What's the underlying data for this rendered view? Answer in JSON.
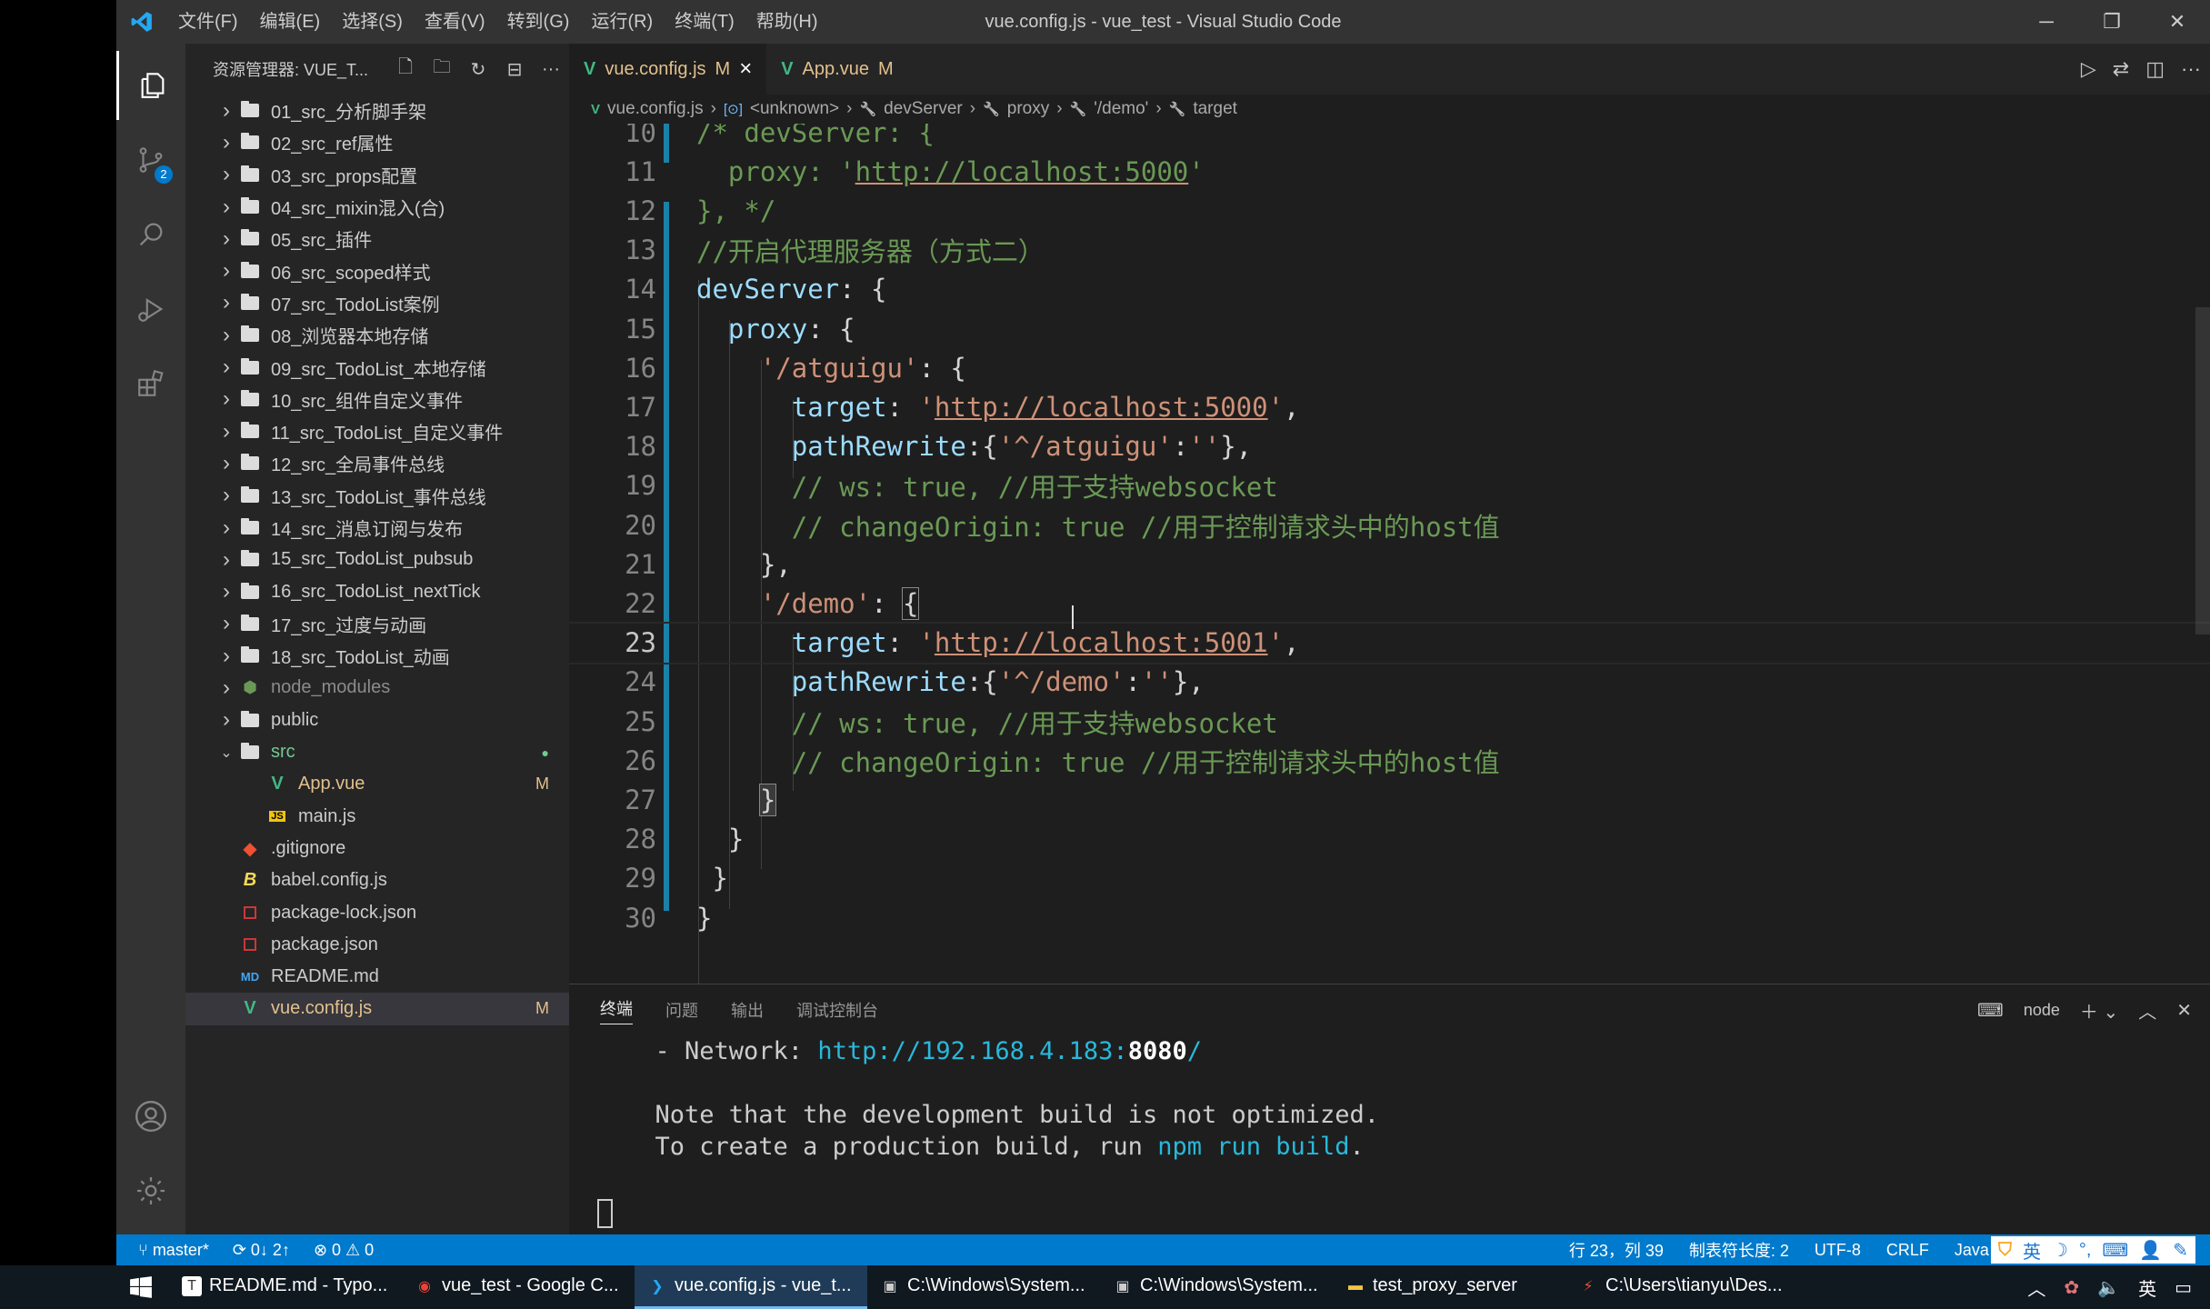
{
  "window": {
    "title": "vue.config.js - vue_test - Visual Studio Code",
    "menu": [
      "文件(F)",
      "编辑(E)",
      "选择(S)",
      "查看(V)",
      "转到(G)",
      "运行(R)",
      "终端(T)",
      "帮助(H)"
    ]
  },
  "activity": {
    "scm_badge": "2"
  },
  "sidebar": {
    "title": "资源管理器: VUE_T...",
    "tree": [
      {
        "label": "01_src_分析脚手架",
        "type": "folder"
      },
      {
        "label": "02_src_ref属性",
        "type": "folder"
      },
      {
        "label": "03_src_props配置",
        "type": "folder"
      },
      {
        "label": "04_src_mixin混入(合)",
        "type": "folder"
      },
      {
        "label": "05_src_插件",
        "type": "folder"
      },
      {
        "label": "06_src_scoped样式",
        "type": "folder"
      },
      {
        "label": "07_src_TodoList案例",
        "type": "folder"
      },
      {
        "label": "08_浏览器本地存储",
        "type": "folder"
      },
      {
        "label": "09_src_TodoList_本地存储",
        "type": "folder"
      },
      {
        "label": "10_src_组件自定义事件",
        "type": "folder"
      },
      {
        "label": "11_src_TodoList_自定义事件",
        "type": "folder"
      },
      {
        "label": "12_src_全局事件总线",
        "type": "folder"
      },
      {
        "label": "13_src_TodoList_事件总线",
        "type": "folder"
      },
      {
        "label": "14_src_消息订阅与发布",
        "type": "folder"
      },
      {
        "label": "15_src_TodoList_pubsub",
        "type": "folder"
      },
      {
        "label": "16_src_TodoList_nextTick",
        "type": "folder"
      },
      {
        "label": "17_src_过度与动画",
        "type": "folder"
      },
      {
        "label": "18_src_TodoList_动画",
        "type": "folder"
      },
      {
        "label": "node_modules",
        "type": "node"
      },
      {
        "label": "public",
        "type": "folder"
      },
      {
        "label": "src",
        "type": "open-folder",
        "status": "●"
      },
      {
        "label": "App.vue",
        "type": "vue",
        "status": "M",
        "indent": 1
      },
      {
        "label": "main.js",
        "type": "js",
        "indent": 1
      },
      {
        "label": ".gitignore",
        "type": "git"
      },
      {
        "label": "babel.config.js",
        "type": "babel"
      },
      {
        "label": "package-lock.json",
        "type": "npm"
      },
      {
        "label": "package.json",
        "type": "npm"
      },
      {
        "label": "README.md",
        "type": "md"
      },
      {
        "label": "vue.config.js",
        "type": "vue",
        "status": "M",
        "selected": true
      }
    ]
  },
  "tabs": [
    {
      "name": "vue.config.js",
      "status": "M",
      "close": "×",
      "active": true
    },
    {
      "name": "App.vue",
      "status": "M",
      "active": false
    }
  ],
  "breadcrumb": [
    "vue.config.js",
    "<unknown>",
    "devServer",
    "proxy",
    "'/demo'",
    "target"
  ],
  "code": {
    "current_line": 23,
    "lines": [
      {
        "n": "10",
        "html": "<span class='c-comment'>/* devServer: {</span>"
      },
      {
        "n": "11",
        "html": "<span class='c-comment'>  proxy: '<u>http://localhost:5000</u>'</span>"
      },
      {
        "n": "12",
        "html": "<span class='c-comment'>}, */</span>"
      },
      {
        "n": "13",
        "html": "<span class='c-comment'>//开启代理服务器（方式二）</span>"
      },
      {
        "n": "14",
        "html": "<span class='c-prop'>devServer</span><span class='c-punc'>: {</span>"
      },
      {
        "n": "15",
        "html": "  <span class='c-prop'>proxy</span><span class='c-punc'>: {</span>"
      },
      {
        "n": "16",
        "html": "    <span class='c-str'>'/atguigu'</span><span class='c-punc'>: {</span>"
      },
      {
        "n": "17",
        "html": "      <span class='c-prop'>target</span><span class='c-punc'>: </span><span class='c-str'>'<u>http://localhost:5000</u>'</span><span class='c-punc'>,</span>"
      },
      {
        "n": "18",
        "html": "      <span class='c-prop'>pathRewrite</span><span class='c-punc'>:{</span><span class='c-str'>'^/atguigu'</span><span class='c-punc'>:</span><span class='c-str'>''</span><span class='c-punc'>},</span>"
      },
      {
        "n": "19",
        "html": "      <span class='c-comment'>// ws: true, //用于支持websocket</span>"
      },
      {
        "n": "20",
        "html": "      <span class='c-comment'>// changeOrigin: true //用于控制请求头中的host值</span>"
      },
      {
        "n": "21",
        "html": "    <span class='c-punc'>},</span>"
      },
      {
        "n": "22",
        "html": "    <span class='c-str'>'/demo'</span><span class='c-punc'>: </span><span class='c-punc' style='outline:1px solid #888'>{</span>"
      },
      {
        "n": "23",
        "html": "      <span class='c-prop'>target</span><span class='c-punc'>: </span><span class='c-str'>'<u>http://localhost:5001</u>'</span><span class='c-punc'>,</span>"
      },
      {
        "n": "24",
        "html": "      <span class='c-prop'>pathRewrite</span><span class='c-punc'>:{</span><span class='c-str'>'^/demo'</span><span class='c-punc'>:</span><span class='c-str'>''</span><span class='c-punc'>},</span>"
      },
      {
        "n": "25",
        "html": "      <span class='c-comment'>// ws: true, //用于支持websocket</span>"
      },
      {
        "n": "26",
        "html": "      <span class='c-comment'>// changeOrigin: true //用于控制请求头中的host值</span>"
      },
      {
        "n": "27",
        "html": "    <span class='c-punc' style='outline:1px solid #888;background:#3a3a3a'>}</span>"
      },
      {
        "n": "28",
        "html": "  <span class='c-punc'>}</span>"
      },
      {
        "n": "29",
        "html": " <span class='c-punc'>}</span>"
      },
      {
        "n": "30",
        "html": "<span class='c-punc'>}</span>"
      }
    ]
  },
  "panel": {
    "tabs": [
      "终端",
      "问题",
      "输出",
      "调试控制台"
    ],
    "active_tab": "终端",
    "terminal_name": "node",
    "output": {
      "network_prefix": "  - Network: ",
      "network_url": "http://192.168.4.183:",
      "network_port": "8080",
      "network_slash": "/",
      "note_line": "  Note that the development build is not optimized.",
      "build_prefix": "  To create a production build, run ",
      "build_cmd": "npm run build",
      "build_suffix": "."
    }
  },
  "statusbar": {
    "branch": "master*",
    "sync": "0↓ 2↑",
    "problems": "⊗ 0 ⚠ 0",
    "position": "行 23，列 39",
    "tab_size": "制表符长度: 2",
    "encoding": "UTF-8",
    "eol": "CRLF",
    "language": "Java",
    "ime": "英"
  },
  "taskbar": {
    "items": [
      {
        "label": "README.md - Typo...",
        "icon": "typora-icon",
        "color": "#ffffff"
      },
      {
        "label": "vue_test - Google C...",
        "icon": "chrome-icon",
        "color": "#ea4335"
      },
      {
        "label": "vue.config.js - vue_t...",
        "icon": "vscode-icon",
        "color": "#23a9f2",
        "active": true
      },
      {
        "label": "C:\\Windows\\System...",
        "icon": "cmd-icon",
        "color": "#cccccc"
      },
      {
        "label": "C:\\Windows\\System...",
        "icon": "cmd-icon",
        "color": "#cccccc"
      },
      {
        "label": "test_proxy_server",
        "icon": "folder-icon",
        "color": "#f5c542"
      },
      {
        "label": "C:\\Users\\tianyu\\Des...",
        "icon": "git-bash-icon",
        "color": "#f05032"
      }
    ],
    "tray_lang": "英"
  }
}
